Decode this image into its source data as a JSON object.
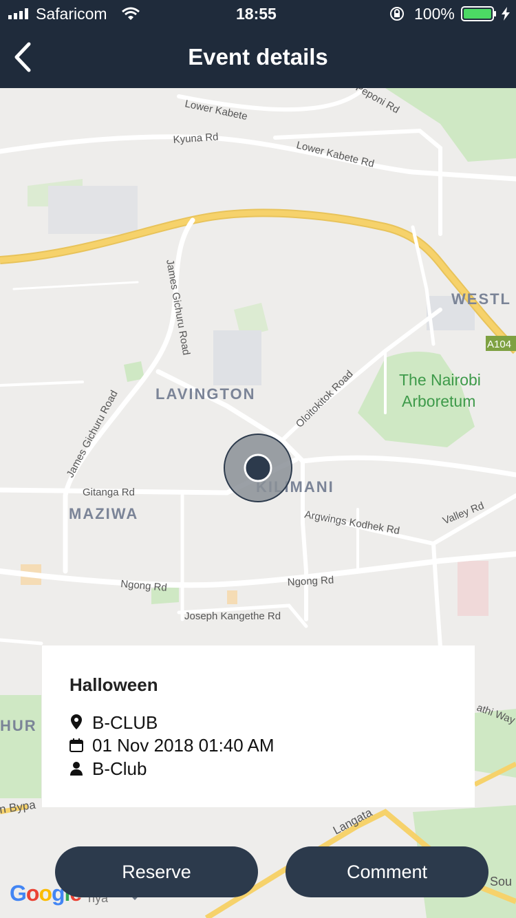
{
  "status_bar": {
    "carrier": "Safaricom",
    "time": "18:55",
    "battery": "100%"
  },
  "nav": {
    "title": "Event details",
    "back_icon": "chevron-left-icon"
  },
  "map": {
    "road_labels": {
      "lower_kabete": "Lower Kabete",
      "kyuna_rd": "Kyuna Rd",
      "lower_kabete_rd": "Lower Kabete Rd",
      "peponi_rd": "Peponi Rd",
      "james_gichuru_road_n": "James Gichuru Road",
      "james_gichuru_road_s": "James Gichuru Road",
      "oloitokitok_road": "Oloitokitok Road",
      "gitanga_rd": "Gitanga Rd",
      "argwings_kodhek_rd": "Argwings Kodhek Rd",
      "valley_rd": "Valley Rd",
      "ngong_rd_w": "Ngong Rd",
      "ngong_rd_e": "Ngong Rd",
      "joseph_kangethe_rd": "Joseph Kangethe Rd",
      "a104": "A104",
      "langata": "Langata",
      "bypass": "n Bypa",
      "mathi_way": "athi Way",
      "sou": "Sou",
      "nya": "nya"
    },
    "area_labels": {
      "westlands": "WESTL",
      "lavington": "LAVINGTON",
      "kilimani": "KILIMANI",
      "maziwa": "MAZIWA",
      "hurl": "HUR"
    },
    "park_labels": {
      "arboretum_1": "The Nairobi",
      "arboretum_2": "Arboretum"
    },
    "attribution": "Google"
  },
  "event": {
    "title": "Halloween",
    "venue": "B-CLUB",
    "datetime": "01 Nov 2018 01:40 AM",
    "organizer": "B-Club"
  },
  "actions": {
    "reserve_label": "Reserve",
    "comment_label": "Comment"
  },
  "colors": {
    "header": "#1f2b3b",
    "button": "#2c3a4c",
    "battery": "#4cd964",
    "highway": "#f6d26b",
    "park": "#cfe8c4"
  }
}
